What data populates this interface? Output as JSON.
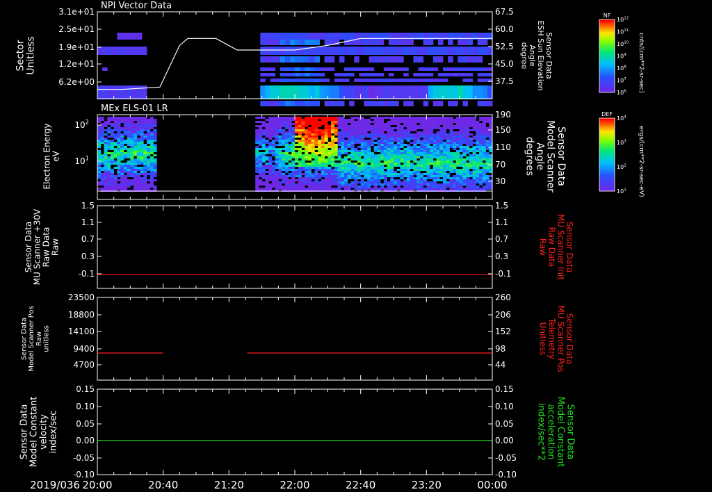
{
  "time_axis": {
    "date_label": "2019/036",
    "ticks": [
      "20:00",
      "20:40",
      "21:20",
      "22:00",
      "22:40",
      "23:20",
      "00:00"
    ]
  },
  "chart_data": [
    {
      "type": "heatmap",
      "title": "NPI Vector Data",
      "ylabel": "Sector Unitless",
      "yticks": [
        "3.1e+01",
        "2.5e+01",
        "1.9e+01",
        "1.2e+01",
        "6.2e+00"
      ],
      "colorbar": {
        "label": "NF",
        "unit": "cnts/(cm**2-sr-sec)",
        "ticks": [
          "10^12",
          "10^11",
          "10^10",
          "10^9",
          "10^8",
          "10^7",
          "10^6"
        ]
      },
      "overlay_line": {
        "name": "ESH Sun Elevation Angle",
        "ylabel": "Sensor Data ESH Sun Elevation Angle degree",
        "yticks": [
          "67.5",
          "60.0",
          "52.5",
          "45.0",
          "37.5"
        ],
        "ylim": [
          30,
          67.5
        ],
        "x_minutes": [
          0,
          15,
          38,
          50,
          55,
          72,
          85,
          120,
          140,
          160,
          170,
          175,
          180,
          191,
          195,
          240
        ],
        "y": [
          34,
          34,
          35,
          53,
          56,
          56,
          51,
          51,
          53,
          56,
          56,
          56,
          56,
          56,
          56,
          56
        ]
      }
    },
    {
      "type": "heatmap",
      "title": "MEx ELS-01 LR",
      "ylabel": "Electron Energy eV",
      "yticks": [
        "10^2",
        "10^1"
      ],
      "right_ylabel": "Sensor Data Model Scanner Angle degrees",
      "right_yticks": [
        "190",
        "150",
        "110",
        "70",
        "30"
      ],
      "colorbar": {
        "label": "DEF",
        "unit": "ergs/(cm**2-sr-sec-eV)",
        "ticks": [
          "10^4",
          "10^3",
          "10^2",
          "10^1"
        ]
      }
    },
    {
      "type": "line",
      "ylabel": "Sensor Data MU Scanner +30V Raw Data Raw",
      "yticks": [
        "1.5",
        "1.1",
        "0.7",
        "0.3",
        "-0.1"
      ],
      "ylim": [
        -0.3,
        1.5
      ],
      "right_ylabel": "Sensor Data MU Scanner Init Raw Data Raw",
      "right_yticks": [
        "1.5",
        "1.1",
        "0.7",
        "0.3",
        "-0.1"
      ],
      "series": [
        {
          "name": "Sensor Data MU Scanner Init Raw Data Raw",
          "color": "#ff2020",
          "x_minutes": [
            0,
            240
          ],
          "y": [
            0.0,
            0.0
          ]
        }
      ]
    },
    {
      "type": "line",
      "ylabel": "Sensor Data Model Scanner Pos Raw unitless",
      "yticks": [
        "23500",
        "18800",
        "14100",
        "9400",
        "4700"
      ],
      "ylim": [
        0,
        23500
      ],
      "right_ylabel": "Sensor Data MU Scanner Pos Telemetry Unitless",
      "right_yticks": [
        "260",
        "206",
        "152",
        "98",
        "44"
      ],
      "series": [
        {
          "name": "Sensor Data MU Scanner Pos Telemetry Unitless",
          "color": "#ff2020",
          "segments_minutes": [
            [
              0,
              40
            ],
            [
              91,
              240
            ]
          ],
          "y": 88
        }
      ]
    },
    {
      "type": "line",
      "ylabel": "Sensor Data Model Constant velocity index/sec",
      "yticks": [
        "0.15",
        "0.10",
        "0.05",
        "0.00",
        "-0.05",
        "-0.10"
      ],
      "ylim": [
        -0.1,
        0.15
      ],
      "right_ylabel": "Sensor Data Model Constant acceleration index/sec**2",
      "right_yticks": [
        "0.15",
        "0.10",
        "0.05",
        "0.00",
        "-0.05",
        "-0.10"
      ],
      "series": [
        {
          "name": "Sensor Data Model Constant acceleration index/sec**2",
          "color": "#20e020",
          "x_minutes": [
            0,
            240
          ],
          "y": [
            0.0,
            0.0
          ]
        }
      ]
    }
  ]
}
